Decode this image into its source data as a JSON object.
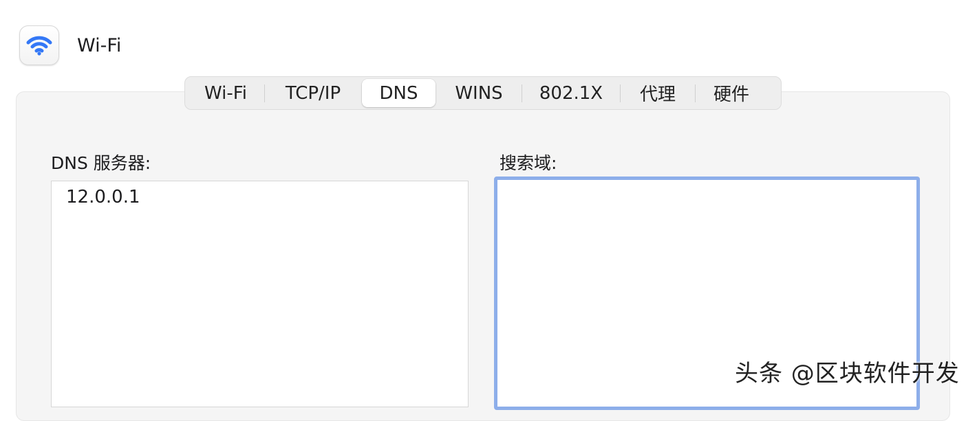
{
  "header": {
    "icon": "wifi-icon",
    "title": "Wi-Fi"
  },
  "tabs": [
    {
      "label": "Wi-Fi",
      "active": false
    },
    {
      "label": "TCP/IP",
      "active": false
    },
    {
      "label": "DNS",
      "active": true
    },
    {
      "label": "WINS",
      "active": false
    },
    {
      "label": "802.1X",
      "active": false
    },
    {
      "label": "代理",
      "active": false
    },
    {
      "label": "硬件",
      "active": false
    }
  ],
  "dns_servers": {
    "label": "DNS 服务器:",
    "entries": [
      "12.0.0.1"
    ]
  },
  "search_domains": {
    "label": "搜索域:",
    "entries": []
  },
  "watermark": "头条 @区块软件开发",
  "colors": {
    "accent": "#3478f6",
    "focus_ring": "#8daeea",
    "panel_bg": "#f5f5f5"
  }
}
